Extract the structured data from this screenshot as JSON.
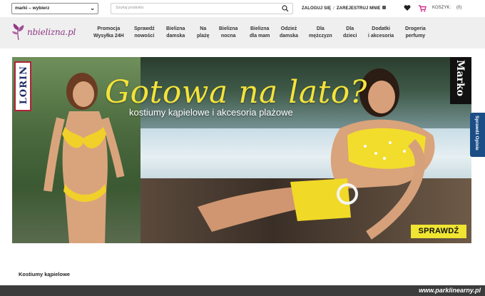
{
  "topbar": {
    "brand_select_value": "marki – wybierz",
    "search_placeholder": "Szukaj produktu",
    "login": "ZALOGUJ SIĘ",
    "separator": "/",
    "register": "ZAREJESTRUJ MNIE",
    "cart_label": "KOSZYK:",
    "cart_count": "(0)"
  },
  "logo": {
    "text": "nbielizna.pl"
  },
  "nav": {
    "items": [
      {
        "line1": "Promocja",
        "line2": "Wysyłka 24H"
      },
      {
        "line1": "Sprawdź",
        "line2": "nowości"
      },
      {
        "line1": "Bielizna",
        "line2": "damska"
      },
      {
        "line1": "Na",
        "line2": "plażę"
      },
      {
        "line1": "Bielizna",
        "line2": "nocna"
      },
      {
        "line1": "Bielizna",
        "line2": "dla mam"
      },
      {
        "line1": "Odzież",
        "line2": "damska"
      },
      {
        "line1": "Dla",
        "line2": "mężczyzn"
      },
      {
        "line1": "Dla",
        "line2": "dzieci"
      },
      {
        "line1": "Dodatki",
        "line2": "i akcesoria"
      },
      {
        "line1": "Drogeria",
        "line2": "perfumy"
      }
    ]
  },
  "hero": {
    "title": "Gotowa na lato?",
    "subtitle": "kostiumy kąpielowe i akcesoria plażowe",
    "brand_left": "LORIN",
    "brand_right": "Marko",
    "cta": "SPRAWDŹ"
  },
  "side_tab": {
    "label": "Sprawdź Opinie"
  },
  "section": {
    "title": "Kostiumy kąpielowe"
  },
  "watermark": "www.parklinearny.pl",
  "colors": {
    "accent": "#8e3a86",
    "cta": "#f0e531",
    "side_tab": "#1b4e86",
    "cart": "#d0338f"
  }
}
